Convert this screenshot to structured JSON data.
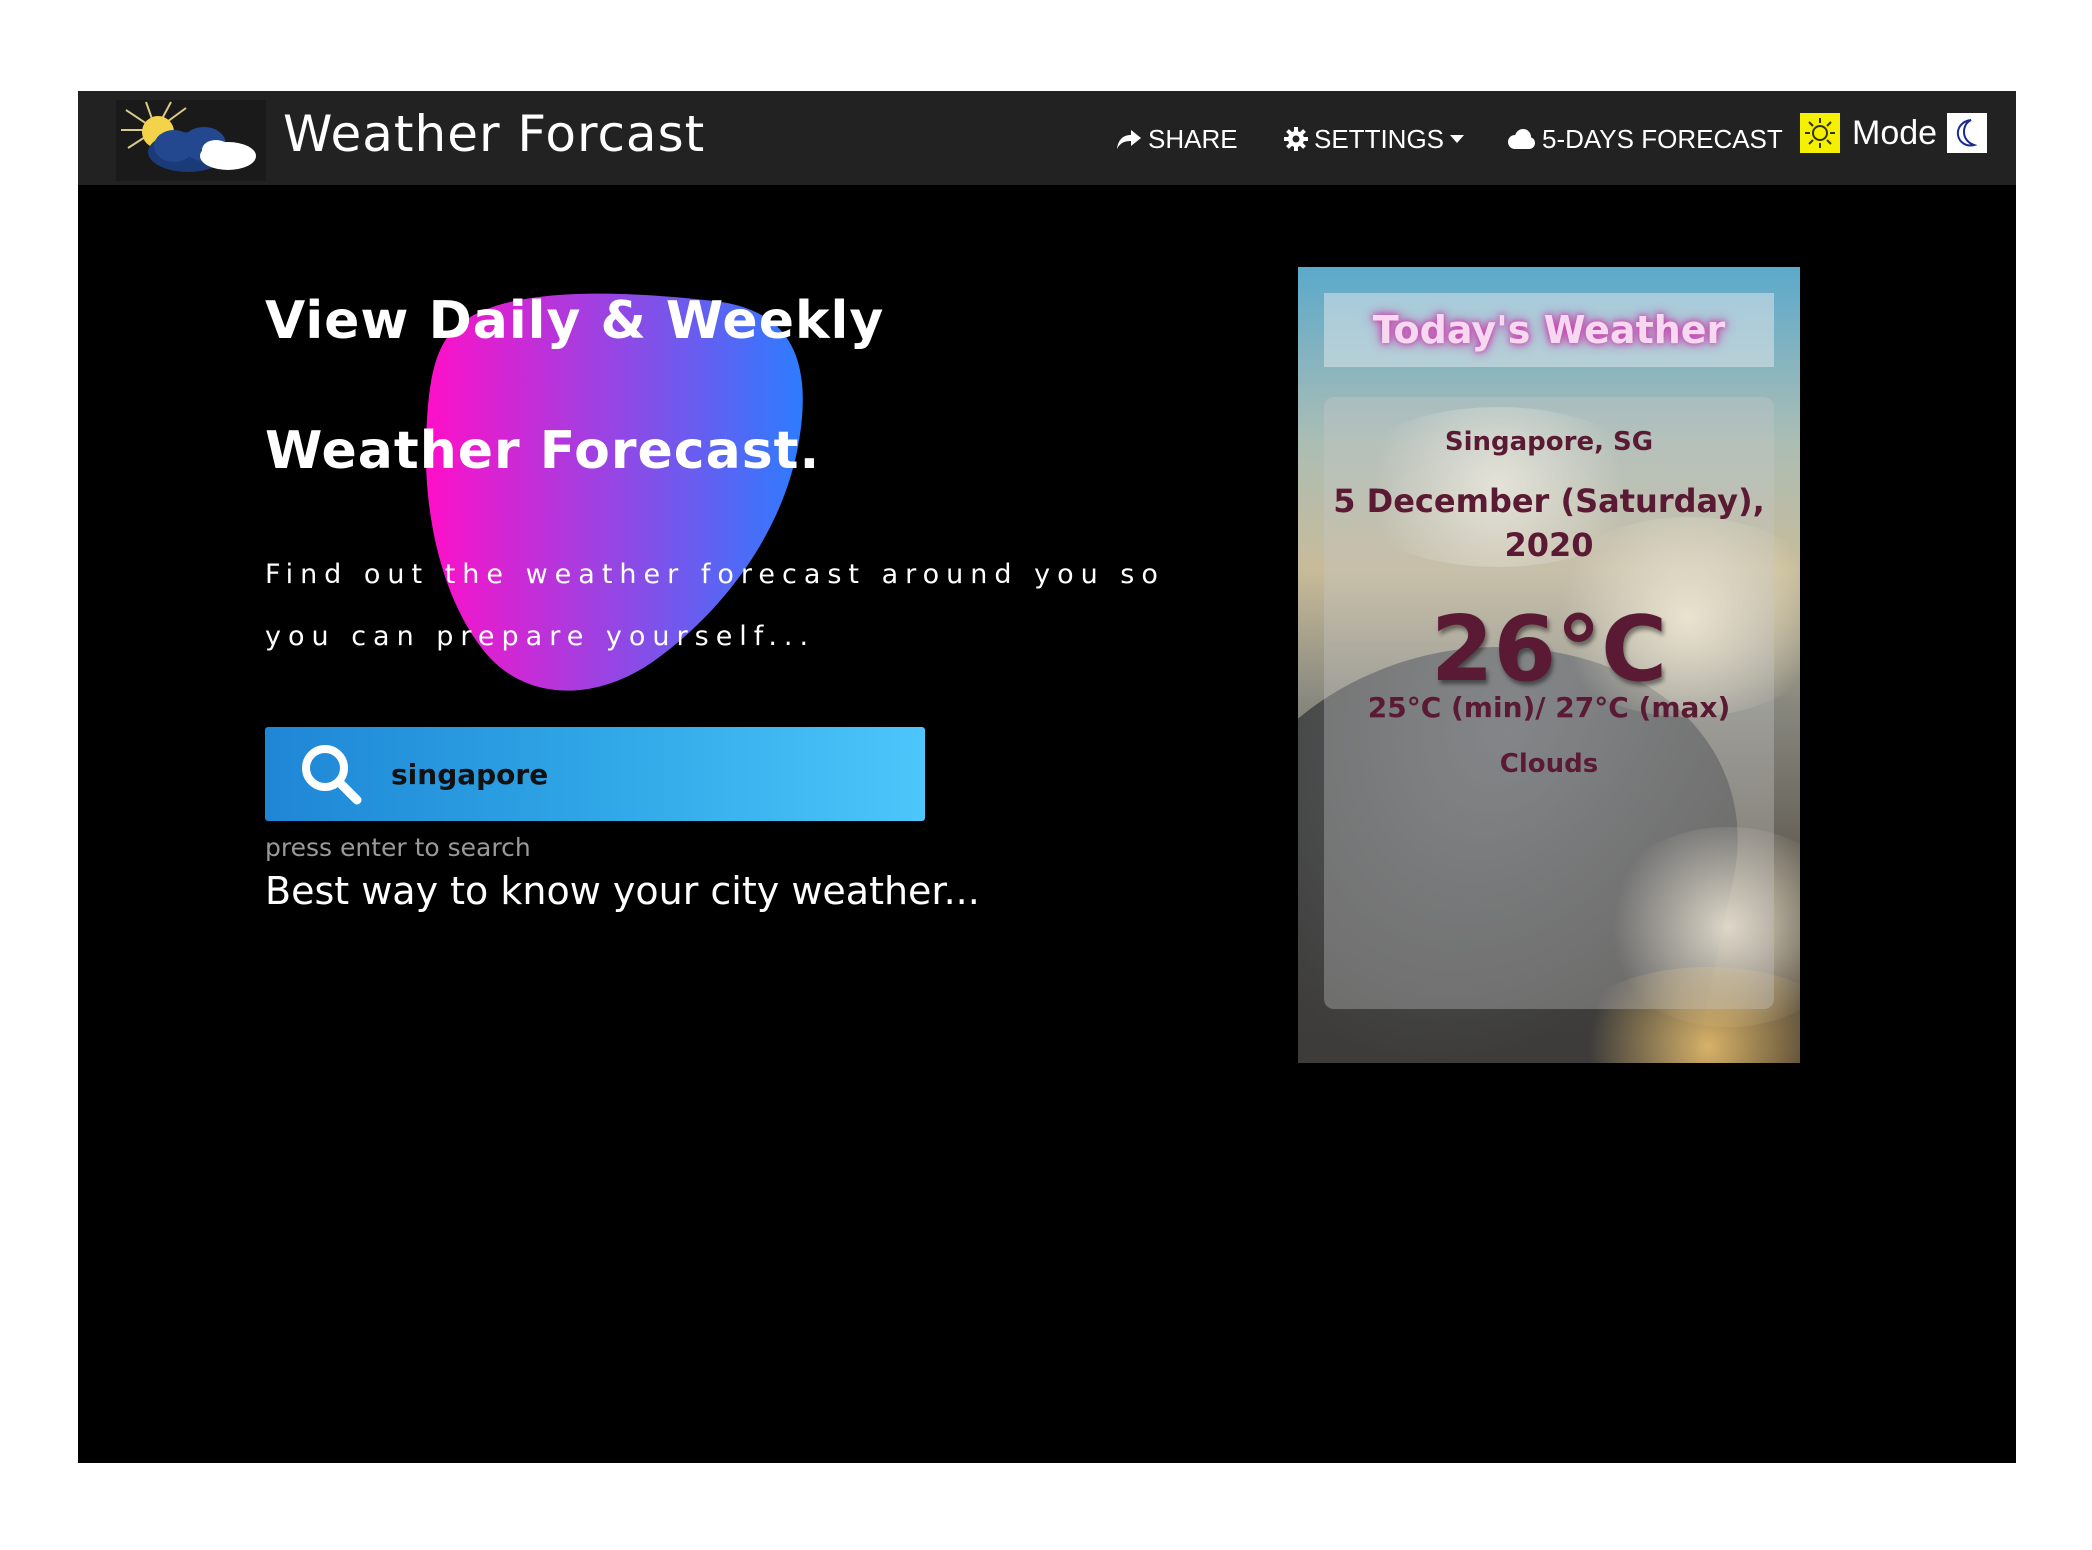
{
  "navbar": {
    "brand_title": "Weather Forcast",
    "logo_icon": "sun-cloud-logo-icon",
    "share_label": "SHARE",
    "settings_label": "SETTINGS",
    "forecast_label": "5-DAYS FORECAST",
    "mode_label": "Mode"
  },
  "hero": {
    "title_line1": "View Daily & Weekly",
    "title_line2": "Weather Forecast.",
    "desc_line1": "Find out the weather forecast around you so",
    "desc_line2": "you can prepare yourself..."
  },
  "search": {
    "value": "singapore",
    "hint": "press enter to search",
    "tagline": "Best way to know your city weather..."
  },
  "weather_card": {
    "header": "Today's Weather",
    "city": "Singapore, SG",
    "date": "5 December (Saturday), 2020",
    "temperature": "26°C",
    "min_max": "25°C (min)/ 27°C (max)",
    "description": "Clouds"
  },
  "colors": {
    "app_background": "#000000",
    "navbar_background": "#222222",
    "search_gradient_start": "#1f86d6",
    "search_gradient_end": "#4cc6fb",
    "blob_gradient_start": "#ff0fc8",
    "blob_gradient_end": "#2c7cff",
    "card_text": "#5a1a33",
    "mode_sun_bg": "#f5f000"
  }
}
